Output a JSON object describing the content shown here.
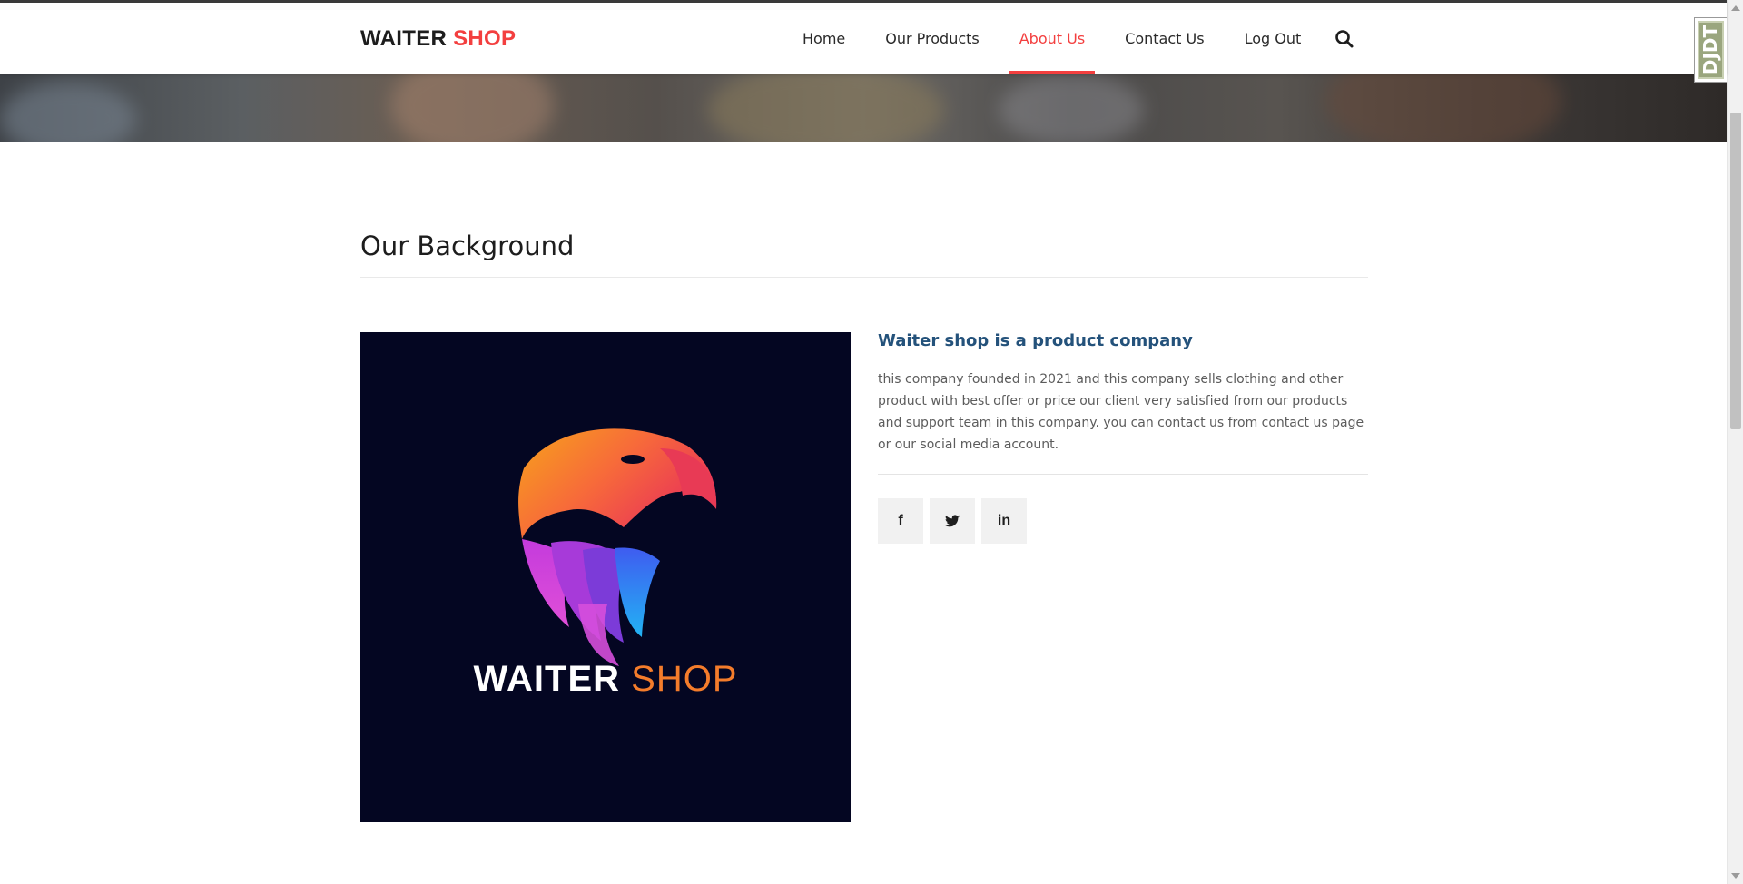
{
  "header": {
    "logo_primary": "WAITER",
    "logo_accent": "SHOP",
    "nav": [
      {
        "label": "Home",
        "active": false
      },
      {
        "label": "Our Products",
        "active": false
      },
      {
        "label": "About Us",
        "active": true
      },
      {
        "label": "Contact Us",
        "active": false
      },
      {
        "label": "Log Out",
        "active": false
      }
    ],
    "search_icon": "search-icon"
  },
  "section": {
    "title": "Our Background"
  },
  "brand_image": {
    "word_primary": "WAITER",
    "word_accent": "SHOP",
    "background": "#040622",
    "accent_color": "#f47c2b"
  },
  "about": {
    "heading": "Waiter shop is a product company",
    "body": "this company founded in 2021 and this company sells clothing and other product with best offer or price our client very satisfied from our products and support team in this company. you can contact us from contact us page or our social media account."
  },
  "social": [
    {
      "icon": "facebook-icon",
      "glyph": "f"
    },
    {
      "icon": "twitter-icon",
      "glyph": "t"
    },
    {
      "icon": "linkedin-icon",
      "glyph": "in"
    }
  ],
  "debug_toolbar": {
    "label": "DJDT"
  },
  "colors": {
    "accent": "#f33f3f",
    "heading_blue": "#24527b",
    "text": "#2a2a2a"
  }
}
